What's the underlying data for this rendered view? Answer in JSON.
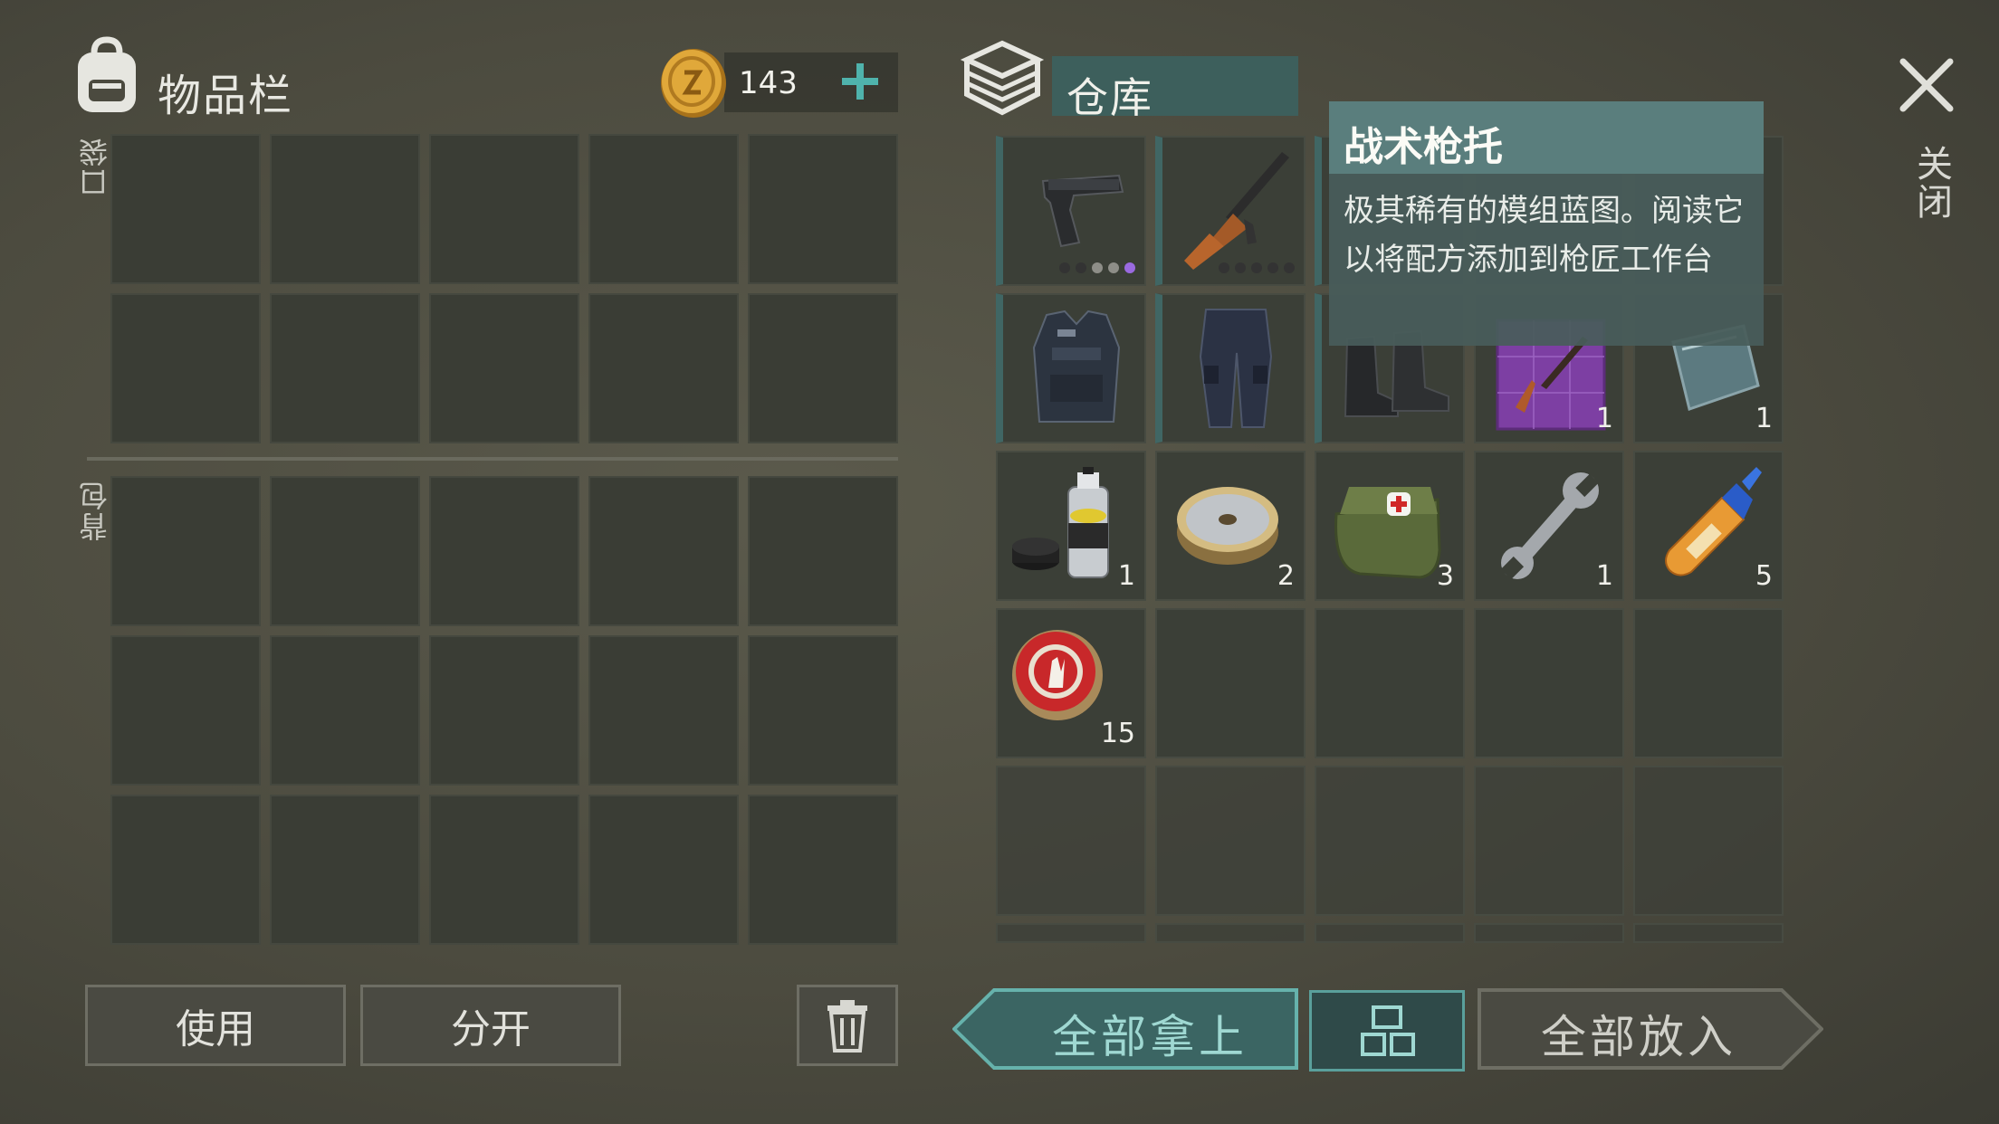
{
  "inventory": {
    "title": "物品栏",
    "coins": "143",
    "pocket_label": "口袋",
    "backpack_label": "背包",
    "use_button": "使用",
    "split_button": "分开"
  },
  "storage": {
    "title": "仓库",
    "items": [
      {
        "name": "pistol",
        "icon": "pistol-icon",
        "count": "",
        "mod_dots": [
          "dark",
          "dark",
          "gray",
          "gray",
          "purple"
        ]
      },
      {
        "name": "assault-rifle",
        "icon": "rifle-icon",
        "count": "",
        "mod_dots": [
          "dark",
          "dark",
          "dark",
          "dark",
          "dark"
        ]
      },
      {
        "name": "police-vest",
        "icon": "vest-icon",
        "count": ""
      },
      {
        "name": "police-pants",
        "icon": "pants-icon",
        "count": ""
      },
      {
        "name": "police-boots",
        "icon": "boots-icon",
        "count": ""
      },
      {
        "name": "blueprint",
        "icon": "blueprint-icon",
        "count": "1"
      },
      {
        "name": "metal-plate",
        "icon": "plate-icon",
        "count": "1"
      },
      {
        "name": "aerosol-paint",
        "icon": "spray-paint-icon",
        "count": "1"
      },
      {
        "name": "wire-spool",
        "icon": "wire-icon",
        "count": "2"
      },
      {
        "name": "medkit-bag",
        "icon": "medkit-icon",
        "count": "3"
      },
      {
        "name": "wrench",
        "icon": "wrench-icon",
        "count": "1"
      },
      {
        "name": "super-glue",
        "icon": "glue-icon",
        "count": "5"
      },
      {
        "name": "bottle-cap",
        "icon": "bottle-cap-icon",
        "count": "15"
      }
    ],
    "take_all_button": "全部拿上",
    "put_all_button": "全部放入"
  },
  "tooltip": {
    "title": "战术枪托",
    "description": "极其稀有的模组蓝图。阅读它以将配方添加到枪匠工作台"
  },
  "close_label": "关闭",
  "colors": {
    "accent_teal": "#5aa09c",
    "slot_bg": "#3a3d35",
    "tooltip_head": "#5a7e7d",
    "mod_purple": "#9a6ae0"
  }
}
